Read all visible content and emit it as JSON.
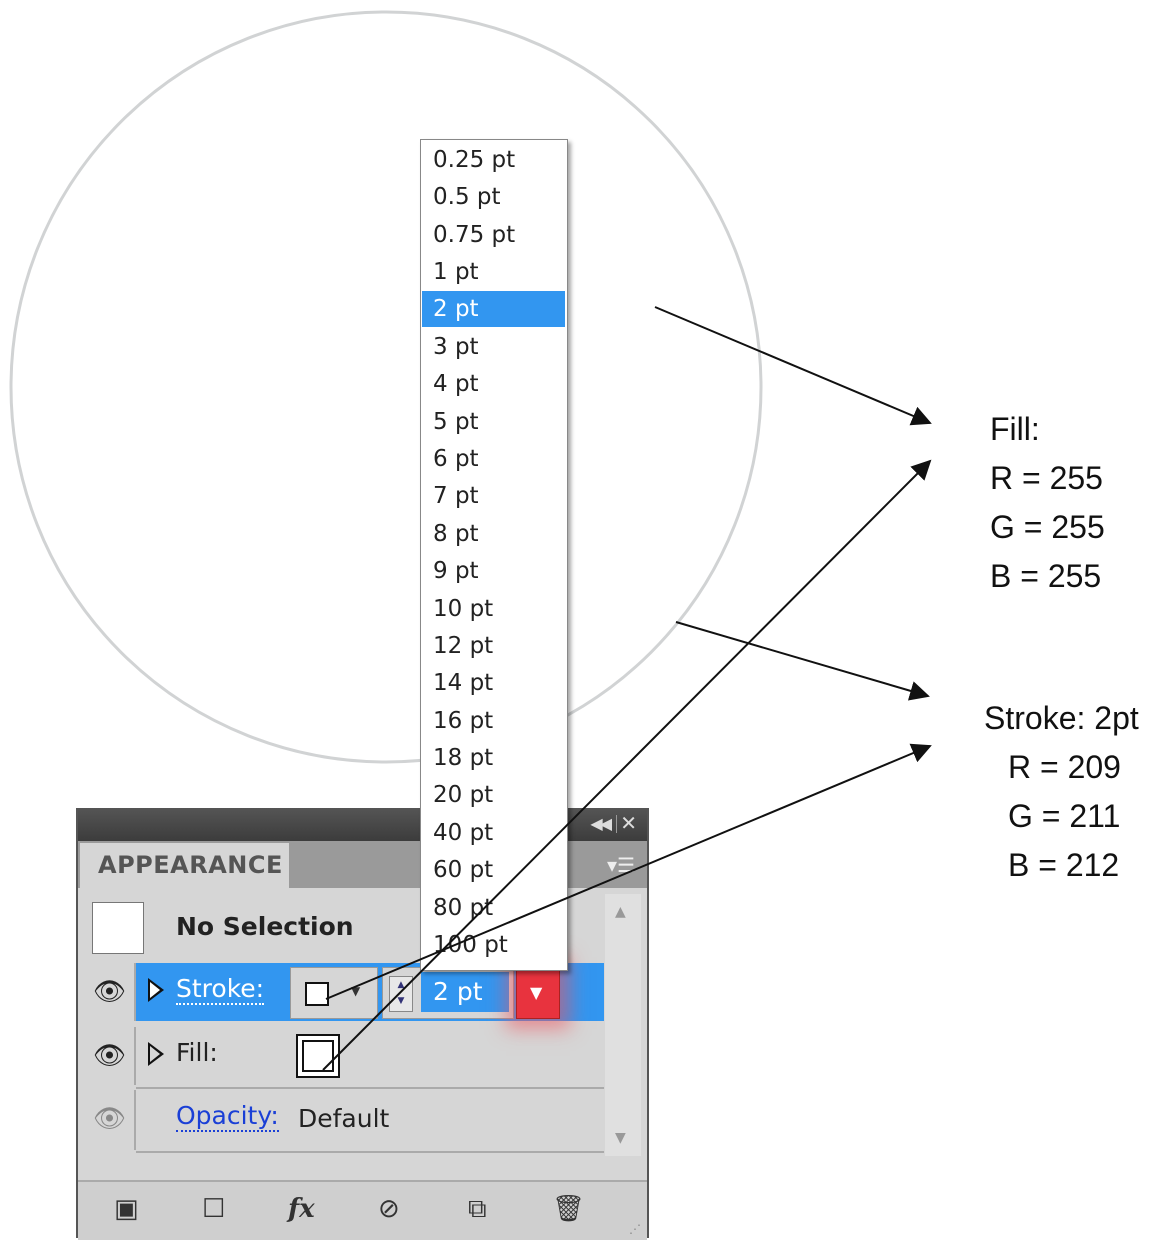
{
  "panel": {
    "tab_title": "APPEARANCE",
    "collapse_icon": "double-left-arrow-icon",
    "close_icon": "close-icon",
    "menu_icon": "panel-menu-icon",
    "no_selection_label": "No Selection",
    "stroke_label": "Stroke:",
    "stroke_weight_value": "2 pt",
    "fill_label": "Fill:",
    "opacity_label": "Opacity:",
    "opacity_value": "Default",
    "bottom_icons": [
      "add-new-stroke-icon",
      "add-new-fill-icon",
      "fx-icon",
      "clear-appearance-icon",
      "duplicate-item-icon",
      "trash-icon"
    ],
    "highlight_color": "#3296f0",
    "dropdown_button_color": "#e8333e"
  },
  "stroke_weight_menu": {
    "items": [
      "0.25 pt",
      "0.5 pt",
      "0.75 pt",
      "1 pt",
      "2 pt",
      "3 pt",
      "4 pt",
      "5 pt",
      "6 pt",
      "7 pt",
      "8 pt",
      "9 pt",
      "10 pt",
      "12 pt",
      "14 pt",
      "16 pt",
      "18 pt",
      "20 pt",
      "40 pt",
      "60 pt",
      "80 pt",
      "100 pt"
    ],
    "selected": "2 pt"
  },
  "annotations": {
    "fill": {
      "title": "Fill:",
      "r": "R = 255",
      "g": "G = 255",
      "b": "B = 255"
    },
    "stroke": {
      "title": "Stroke: 2pt",
      "r": "R = 209",
      "g": "G = 211",
      "b": "B = 212"
    }
  },
  "circle": {
    "fill_color": "#ffffff",
    "stroke_color": "#d1d3d4"
  }
}
